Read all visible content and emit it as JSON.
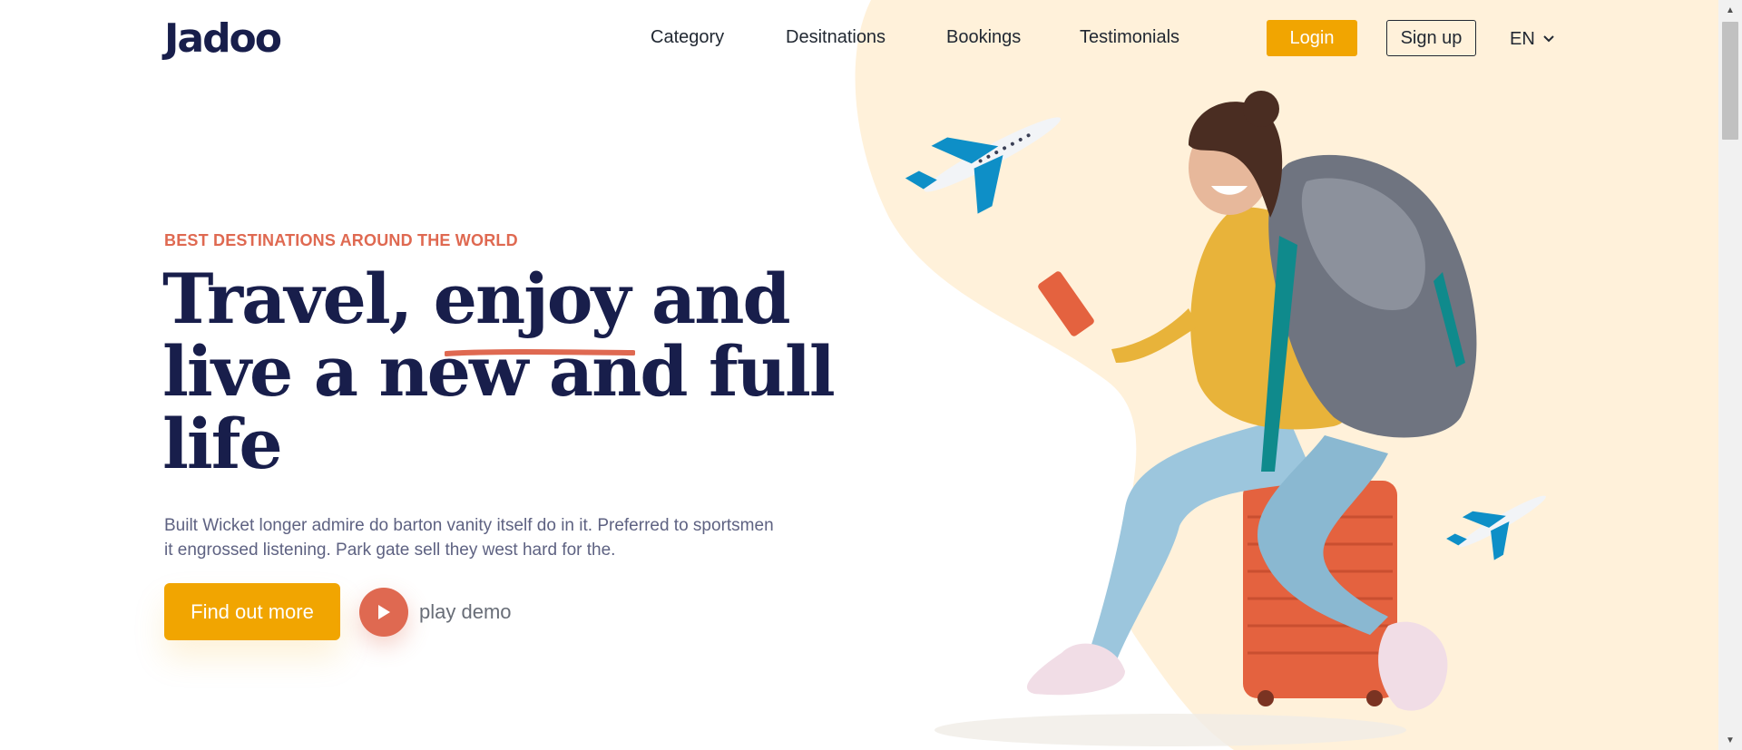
{
  "brand": {
    "logo_text": "Jadoo"
  },
  "nav": {
    "items": [
      {
        "label": "Category"
      },
      {
        "label": "Desitnations"
      },
      {
        "label": "Bookings"
      },
      {
        "label": "Testimonials"
      }
    ],
    "login_label": "Login",
    "signup_label": "Sign up",
    "language": "EN"
  },
  "hero": {
    "eyebrow": "BEST DESTINATIONS AROUND THE WORLD",
    "headline_line1a": "Travel, ",
    "headline_highlight": "enjoy",
    "headline_line1b": " and",
    "headline_line2": "live a new and full",
    "headline_line3": "life",
    "description": "Built Wicket longer admire do barton vanity itself do in it. Preferred to sportsmen it engrossed listening. Park gate sell they west hard for the.",
    "cta_label": "Find out more",
    "demo_label": "play demo"
  },
  "colors": {
    "accent": "#F1A501",
    "highlight": "#DF6951",
    "heading": "#181E4B",
    "body_text": "#5E6282",
    "blob": "#FFF1DA"
  },
  "icons": [
    "chevron-down-icon",
    "play-icon",
    "airplane-icon",
    "traveler-illustration"
  ]
}
